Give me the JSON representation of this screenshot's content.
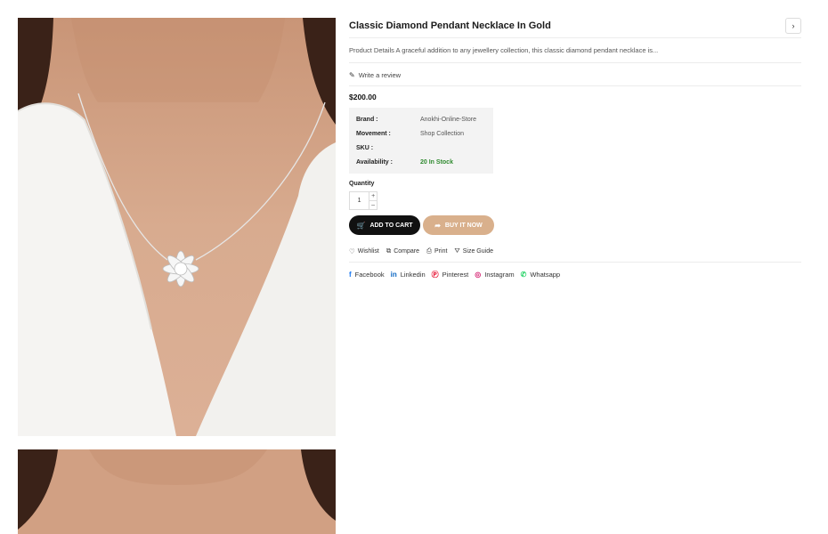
{
  "product": {
    "title": "Classic Diamond Pendant Necklace In Gold",
    "description": "Product Details A graceful addition to any jewellery collection, this classic diamond pendant necklace is...",
    "review_link": "Write a review",
    "price": "$200.00"
  },
  "nav": {
    "next_icon": "›"
  },
  "specs": [
    {
      "key": "Brand :",
      "value": "Anokhi-Online-Store"
    },
    {
      "key": "Movement :",
      "value": "Shop Collection"
    },
    {
      "key": "SKU :",
      "value": ""
    },
    {
      "key": "Availability :",
      "value": "20 In Stock"
    }
  ],
  "quantity": {
    "label": "Quantity",
    "value": "1",
    "plus": "+",
    "minus": "–"
  },
  "buttons": {
    "add_to_cart": "ADD TO CART",
    "buy_now": "BUY IT NOW"
  },
  "links": {
    "wishlist": "Wishlist",
    "compare": "Compare",
    "print": "Print",
    "size_guide": "Size Guide"
  },
  "social": {
    "facebook": "Facebook",
    "linkedin": "Linkedin",
    "pinterest": "Pinterest",
    "instagram": "Instagram",
    "whatsapp": "Whatsapp"
  },
  "colors": {
    "stock": "#2f8a2f",
    "buy_button": "#d9b08c",
    "cart_button": "#111111",
    "facebook": "#1877f2",
    "linkedin": "#0a66c2",
    "pinterest": "#e60023",
    "instagram": "#d62976",
    "whatsapp": "#25d366"
  }
}
